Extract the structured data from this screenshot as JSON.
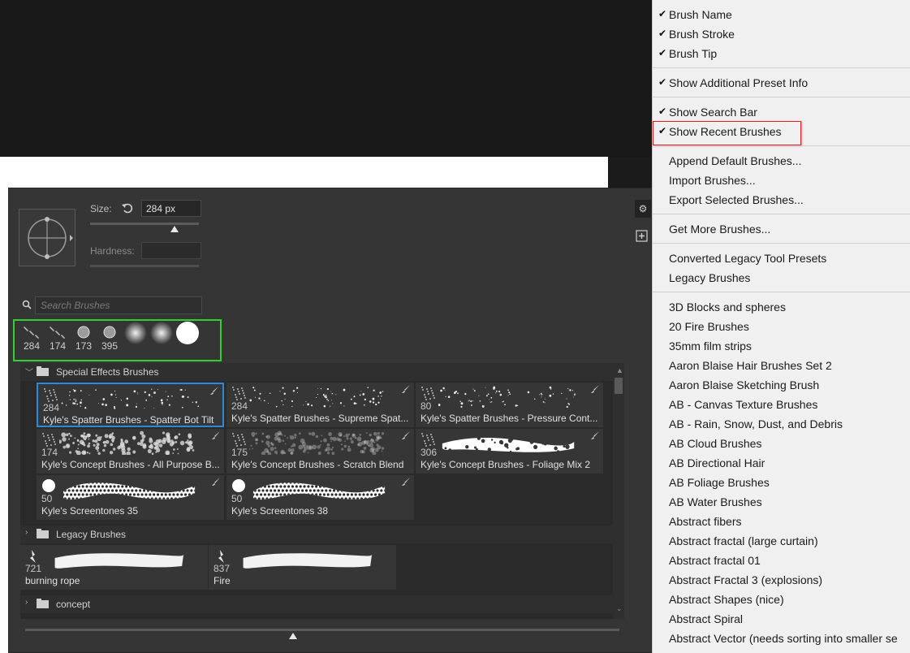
{
  "panel": {
    "size_label": "Size:",
    "size_value": "284 px",
    "hardness_label": "Hardness:",
    "search_placeholder": "Search Brushes",
    "recent": [
      "284",
      "174",
      "173",
      "395",
      "",
      "",
      ""
    ],
    "groups": [
      {
        "name": "Special Effects Brushes",
        "expanded": true
      },
      {
        "name": "Legacy Brushes",
        "expanded": false
      },
      {
        "name": "concept",
        "expanded": false
      }
    ],
    "tiles": [
      {
        "num": "284",
        "name": "Kyle's Spatter Brushes - Spatter Bot Tilt",
        "selected": true
      },
      {
        "num": "284",
        "name": "Kyle's Spatter Brushes - Supreme Spat..."
      },
      {
        "num": "80",
        "name": "Kyle's Spatter Brushes - Pressure Cont..."
      },
      {
        "num": "174",
        "name": "Kyle's Concept Brushes - All Purpose B..."
      },
      {
        "num": "175",
        "name": "Kyle's Concept Brushes - Scratch Blend"
      },
      {
        "num": "306",
        "name": "Kyle's Concept Brushes - Foliage Mix 2"
      },
      {
        "num": "50",
        "name": "Kyle's Screentones 35"
      },
      {
        "num": "50",
        "name": "Kyle's Screentones 38"
      },
      {
        "num": "721",
        "name": "burning rope"
      },
      {
        "num": "837",
        "name": "Fire"
      }
    ]
  },
  "menu": {
    "items": [
      {
        "label": "Brush Name",
        "checked": true
      },
      {
        "label": "Brush Stroke",
        "checked": true
      },
      {
        "label": "Brush Tip",
        "checked": true
      },
      {
        "label": "Show Additional Preset Info",
        "checked": true
      },
      {
        "label": "Show Search Bar",
        "checked": true
      },
      {
        "label": "Show Recent Brushes",
        "checked": true
      },
      {
        "label": "Append Default Brushes...",
        "checked": false
      },
      {
        "label": "Import Brushes...",
        "checked": false
      },
      {
        "label": "Export Selected Brushes...",
        "checked": false
      },
      {
        "label": "Get More Brushes...",
        "checked": false
      },
      {
        "label": "Converted Legacy Tool Presets",
        "checked": false
      },
      {
        "label": "Legacy Brushes",
        "checked": false
      },
      {
        "label": "3D Blocks and spheres",
        "checked": false
      },
      {
        "label": "20 Fire Brushes",
        "checked": false
      },
      {
        "label": "35mm film strips",
        "checked": false
      },
      {
        "label": "Aaron Blaise Hair Brushes Set 2",
        "checked": false
      },
      {
        "label": "Aaron Blaise Sketching Brush",
        "checked": false
      },
      {
        "label": "AB - Canvas Texture Brushes",
        "checked": false
      },
      {
        "label": "AB - Rain, Snow, Dust, and Debris",
        "checked": false
      },
      {
        "label": "AB Cloud Brushes",
        "checked": false
      },
      {
        "label": "AB Directional Hair",
        "checked": false
      },
      {
        "label": "AB Foliage Brushes",
        "checked": false
      },
      {
        "label": "AB Water Brushes",
        "checked": false
      },
      {
        "label": "Abstract fibers",
        "checked": false
      },
      {
        "label": "Abstract fractal (large curtain)",
        "checked": false
      },
      {
        "label": "Abstract fractal 01",
        "checked": false
      },
      {
        "label": "Abstract Fractal 3 (explosions)",
        "checked": false
      },
      {
        "label": "Abstract Shapes (nice)",
        "checked": false
      },
      {
        "label": "Abstract Spiral",
        "checked": false
      },
      {
        "label": "Abstract Vector (needs sorting into smaller se",
        "checked": false
      }
    ]
  },
  "colors": {
    "highlight_recent": "#2fd02f",
    "highlight_menu": "#e02020",
    "selection": "#2a8ad8"
  }
}
